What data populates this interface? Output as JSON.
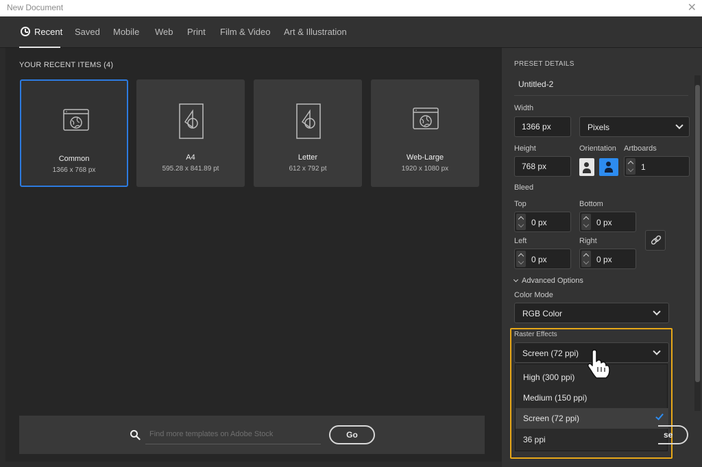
{
  "window": {
    "title": "New Document",
    "close_glyph": "✕"
  },
  "tabs": [
    {
      "label": "Recent",
      "icon": "clock-icon",
      "active": true
    },
    {
      "label": "Saved"
    },
    {
      "label": "Mobile"
    },
    {
      "label": "Web"
    },
    {
      "label": "Print"
    },
    {
      "label": "Film & Video"
    },
    {
      "label": "Art & Illustration"
    }
  ],
  "recent": {
    "heading": "YOUR RECENT ITEMS  (4)",
    "items": [
      {
        "name": "Common",
        "size": "1366 x 768 px",
        "icon": "web-document-icon",
        "selected": true
      },
      {
        "name": "A4",
        "size": "595.28 x 841.89 pt",
        "icon": "print-document-icon"
      },
      {
        "name": "Letter",
        "size": "612 x 792 pt",
        "icon": "print-document-icon"
      },
      {
        "name": "Web-Large",
        "size": "1920 x 1080 px",
        "icon": "web-document-icon"
      }
    ]
  },
  "search": {
    "placeholder": "Find more templates on Adobe Stock",
    "go_label": "Go"
  },
  "preset": {
    "title": "PRESET DETAILS",
    "name": "Untitled-2",
    "width_label": "Width",
    "width_value": "1366 px",
    "units": "Pixels",
    "height_label": "Height",
    "height_value": "768 px",
    "orientation_label": "Orientation",
    "artboards_label": "Artboards",
    "artboards_value": "1",
    "bleed_label": "Bleed",
    "top_label": "Top",
    "top_value": "0 px",
    "bottom_label": "Bottom",
    "bottom_value": "0 px",
    "left_label": "Left",
    "left_value": "0 px",
    "right_label": "Right",
    "right_value": "0 px",
    "advanced_label": "Advanced Options",
    "color_mode_label": "Color Mode",
    "color_mode_value": "RGB Color",
    "raster_label": "Raster Effects",
    "raster_value": "Screen (72 ppi)",
    "raster_options": [
      {
        "label": "High (300 ppi)"
      },
      {
        "label": "Medium (150 ppi)"
      },
      {
        "label": "Screen (72 ppi)",
        "checked": true
      },
      {
        "label": "36 ppi"
      }
    ],
    "partial_button": "se"
  },
  "colors": {
    "accent": "#2d8cf0",
    "selection": "#2d7be0",
    "highlight": "#e8a818"
  }
}
